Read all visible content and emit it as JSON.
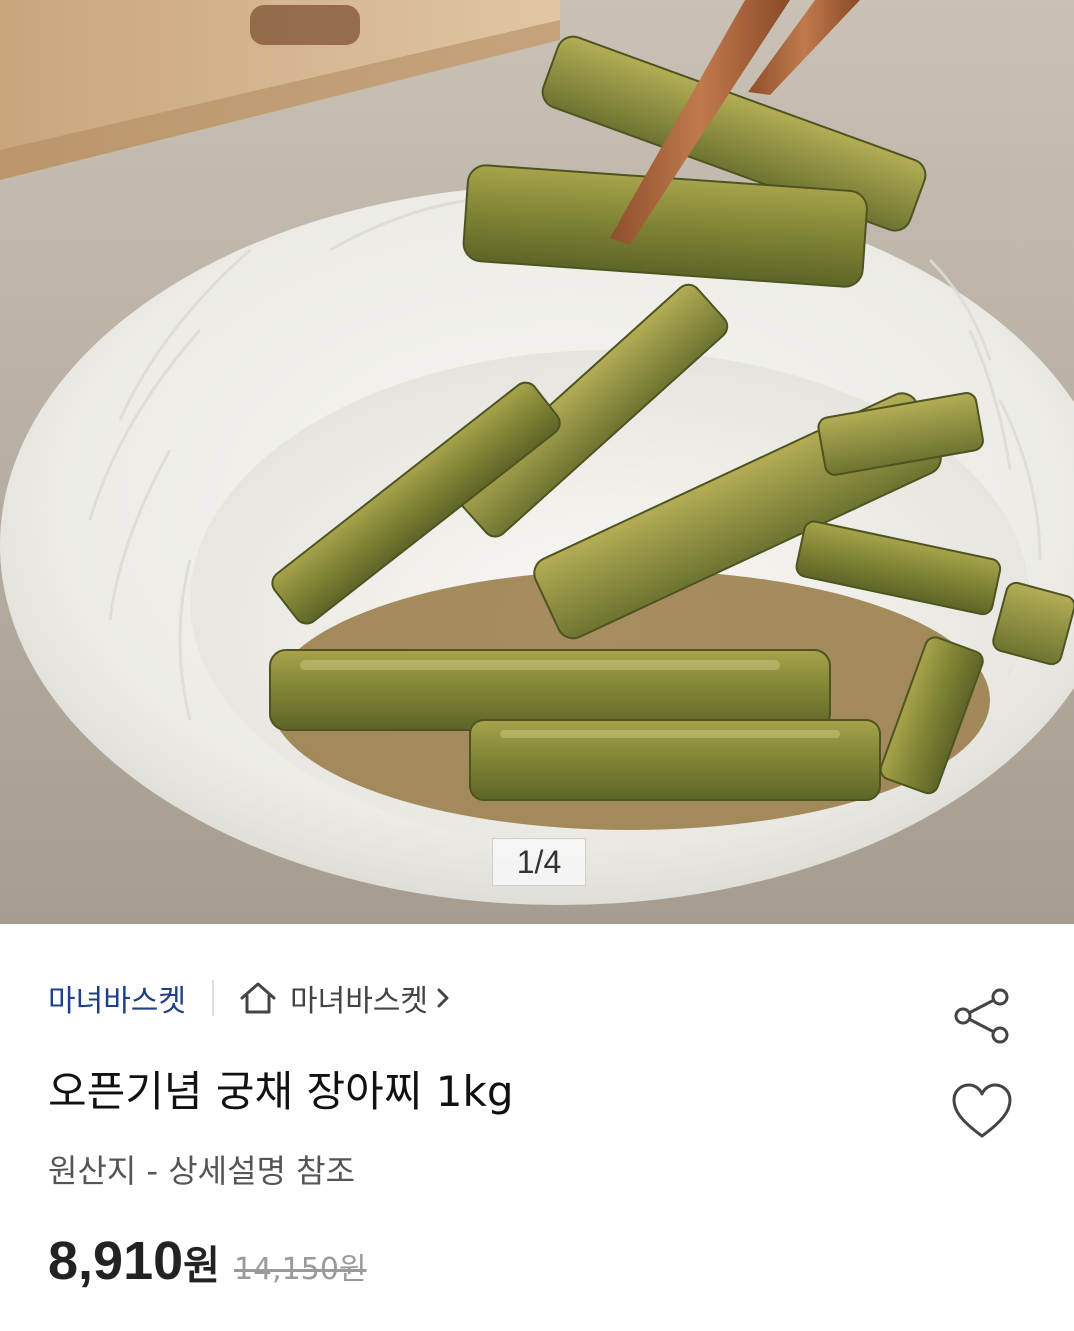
{
  "gallery": {
    "counter": "1/4",
    "image_alt": "궁채 장아찌"
  },
  "product": {
    "brand": "마녀바스켓",
    "store_link": "마녀바스켓",
    "title": "오픈기념 궁채 장아찌 1kg",
    "origin": "원산지 - 상세설명 참조",
    "price": "8,910",
    "price_unit": "원",
    "original_price": "14,150원"
  },
  "icons": {
    "store": "home-icon",
    "store_chevron": "chevron-right-icon",
    "share": "share-icon",
    "like": "heart-icon"
  },
  "colors": {
    "brand": "#1e3f8a",
    "price": "#222222",
    "original_price": "#9a9a9a"
  }
}
